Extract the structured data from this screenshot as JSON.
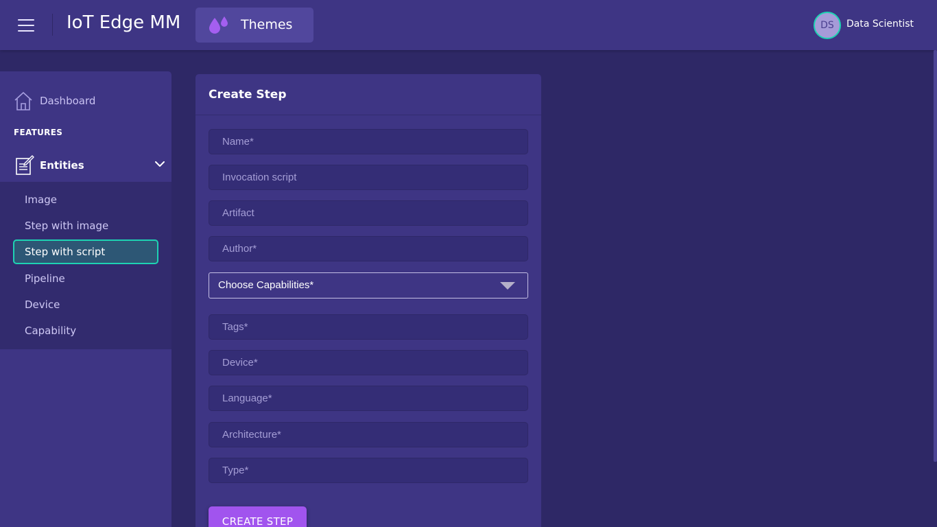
{
  "header": {
    "title": "IoT Edge MM",
    "themes_label": "Themes",
    "user": {
      "initials": "DS",
      "name": "Data Scientist"
    }
  },
  "sidebar": {
    "dashboard_label": "Dashboard",
    "section_title": "FEATURES",
    "entities_label": "Entities",
    "items": [
      {
        "label": "Image",
        "active": false
      },
      {
        "label": "Step with image",
        "active": false
      },
      {
        "label": "Step with script",
        "active": true
      },
      {
        "label": "Pipeline",
        "active": false
      },
      {
        "label": "Device",
        "active": false
      },
      {
        "label": "Capability",
        "active": false
      }
    ]
  },
  "form": {
    "title": "Create Step",
    "fields": [
      {
        "placeholder": "Name*",
        "value": ""
      },
      {
        "placeholder": "Invocation script",
        "value": ""
      },
      {
        "placeholder": "Artifact",
        "value": ""
      },
      {
        "placeholder": "Author*",
        "value": ""
      },
      {
        "placeholder": "Tags*",
        "value": ""
      },
      {
        "placeholder": "Device*",
        "value": ""
      },
      {
        "placeholder": "Language*",
        "value": ""
      },
      {
        "placeholder": "Architecture*",
        "value": ""
      },
      {
        "placeholder": "Type*",
        "value": ""
      }
    ],
    "capabilities_select": {
      "selected": "Choose Capabilities*"
    },
    "submit_label": "CREATE STEP"
  },
  "colors": {
    "background": "#2e2866",
    "surface": "#3e3584",
    "accent": "#1ed3b3",
    "button": "#a154ee"
  }
}
